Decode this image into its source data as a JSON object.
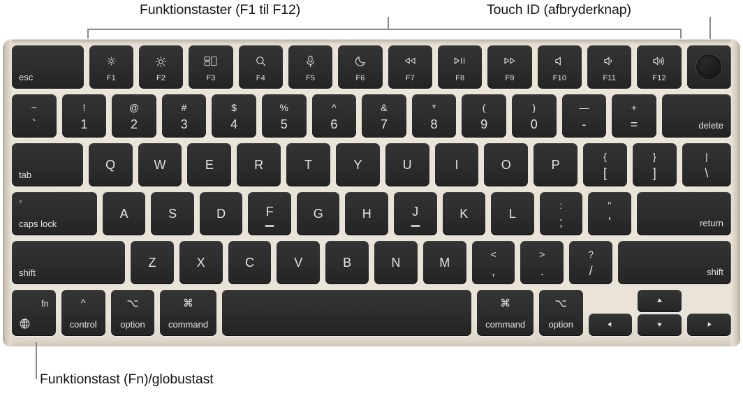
{
  "callouts": {
    "function_keys": "Funktionstaster (F1 til F12)",
    "touch_id": "Touch ID (afbryderknap)",
    "fn_globe": "Funktionstast (Fn)/globustast"
  },
  "colors": {
    "deck": "#e9e3d8",
    "key_face": "#2c2c2c",
    "legend": "#e6e4e0",
    "leader_line": "#8a8a8a",
    "caption_text": "#141414"
  },
  "keyboard": {
    "layout": "Apple Magic Keyboard with Touch ID — US ANSI",
    "rows": {
      "function_row": [
        {
          "name": "esc",
          "label": "esc"
        },
        {
          "name": "f1",
          "icon": "brightness-down-icon",
          "fkey": "F1"
        },
        {
          "name": "f2",
          "icon": "brightness-up-icon",
          "fkey": "F2"
        },
        {
          "name": "f3",
          "icon": "mission-control-icon",
          "fkey": "F3"
        },
        {
          "name": "f4",
          "icon": "spotlight-search-icon",
          "fkey": "F4"
        },
        {
          "name": "f5",
          "icon": "dictation-microphone-icon",
          "fkey": "F5"
        },
        {
          "name": "f6",
          "icon": "do-not-disturb-moon-icon",
          "fkey": "F6"
        },
        {
          "name": "f7",
          "icon": "rewind-icon",
          "fkey": "F7"
        },
        {
          "name": "f8",
          "icon": "play-pause-icon",
          "fkey": "F8"
        },
        {
          "name": "f9",
          "icon": "fast-forward-icon",
          "fkey": "F9"
        },
        {
          "name": "f10",
          "icon": "volume-mute-icon",
          "fkey": "F10"
        },
        {
          "name": "f11",
          "icon": "volume-down-icon",
          "fkey": "F11"
        },
        {
          "name": "f12",
          "icon": "volume-up-icon",
          "fkey": "F12"
        },
        {
          "name": "touch-id",
          "icon": "touch-id-icon",
          "label": ""
        }
      ],
      "number_row": [
        {
          "name": "grave",
          "upper": "~",
          "lower": "`"
        },
        {
          "name": "1",
          "upper": "!",
          "lower": "1"
        },
        {
          "name": "2",
          "upper": "@",
          "lower": "2"
        },
        {
          "name": "3",
          "upper": "#",
          "lower": "3"
        },
        {
          "name": "4",
          "upper": "$",
          "lower": "4"
        },
        {
          "name": "5",
          "upper": "%",
          "lower": "5"
        },
        {
          "name": "6",
          "upper": "^",
          "lower": "6"
        },
        {
          "name": "7",
          "upper": "&",
          "lower": "7"
        },
        {
          "name": "8",
          "upper": "*",
          "lower": "8"
        },
        {
          "name": "9",
          "upper": "(",
          "lower": "9"
        },
        {
          "name": "0",
          "upper": ")",
          "lower": "0"
        },
        {
          "name": "minus",
          "upper": "—",
          "lower": "-"
        },
        {
          "name": "equal",
          "upper": "+",
          "lower": "="
        },
        {
          "name": "delete",
          "label": "delete"
        }
      ],
      "qwerty_row": [
        {
          "name": "tab",
          "label": "tab"
        },
        {
          "name": "q",
          "label": "Q"
        },
        {
          "name": "w",
          "label": "W"
        },
        {
          "name": "e",
          "label": "E"
        },
        {
          "name": "r",
          "label": "R"
        },
        {
          "name": "t",
          "label": "T"
        },
        {
          "name": "y",
          "label": "Y"
        },
        {
          "name": "u",
          "label": "U"
        },
        {
          "name": "i",
          "label": "I"
        },
        {
          "name": "o",
          "label": "O"
        },
        {
          "name": "p",
          "label": "P"
        },
        {
          "name": "bracket-left",
          "upper": "{",
          "lower": "["
        },
        {
          "name": "bracket-right",
          "upper": "}",
          "lower": "]"
        },
        {
          "name": "backslash",
          "upper": "|",
          "lower": "\\"
        }
      ],
      "home_row": [
        {
          "name": "caps-lock",
          "label": "caps lock"
        },
        {
          "name": "a",
          "label": "A"
        },
        {
          "name": "s",
          "label": "S"
        },
        {
          "name": "d",
          "label": "D"
        },
        {
          "name": "f",
          "label": "F"
        },
        {
          "name": "g",
          "label": "G"
        },
        {
          "name": "h",
          "label": "H"
        },
        {
          "name": "j",
          "label": "J"
        },
        {
          "name": "k",
          "label": "K"
        },
        {
          "name": "l",
          "label": "L"
        },
        {
          "name": "semicolon",
          "upper": ":",
          "lower": ";"
        },
        {
          "name": "quote",
          "upper": "\"",
          "lower": "'"
        },
        {
          "name": "return",
          "label": "return"
        }
      ],
      "shift_row": [
        {
          "name": "shift-left",
          "label": "shift"
        },
        {
          "name": "z",
          "label": "Z"
        },
        {
          "name": "x",
          "label": "X"
        },
        {
          "name": "c",
          "label": "C"
        },
        {
          "name": "v",
          "label": "V"
        },
        {
          "name": "b",
          "label": "B"
        },
        {
          "name": "n",
          "label": "N"
        },
        {
          "name": "m",
          "label": "M"
        },
        {
          "name": "comma",
          "upper": "<",
          "lower": ","
        },
        {
          "name": "period",
          "upper": ">",
          "lower": "."
        },
        {
          "name": "slash",
          "upper": "?",
          "lower": "/"
        },
        {
          "name": "shift-right",
          "label": "shift"
        }
      ],
      "bottom_row": [
        {
          "name": "fn-globe",
          "label": "fn",
          "icon": "globe-icon"
        },
        {
          "name": "control-left",
          "symbol": "^",
          "label": "control"
        },
        {
          "name": "option-left",
          "symbol": "⌥",
          "label": "option"
        },
        {
          "name": "command-left",
          "symbol": "⌘",
          "label": "command"
        },
        {
          "name": "space",
          "label": ""
        },
        {
          "name": "command-right",
          "symbol": "⌘",
          "label": "command"
        },
        {
          "name": "option-right",
          "symbol": "⌥",
          "label": "option"
        },
        {
          "name": "arrow-left",
          "icon": "arrow-left-icon"
        },
        {
          "name": "arrow-up",
          "icon": "arrow-up-icon"
        },
        {
          "name": "arrow-down",
          "icon": "arrow-down-icon"
        },
        {
          "name": "arrow-right",
          "icon": "arrow-right-icon"
        }
      ]
    }
  }
}
